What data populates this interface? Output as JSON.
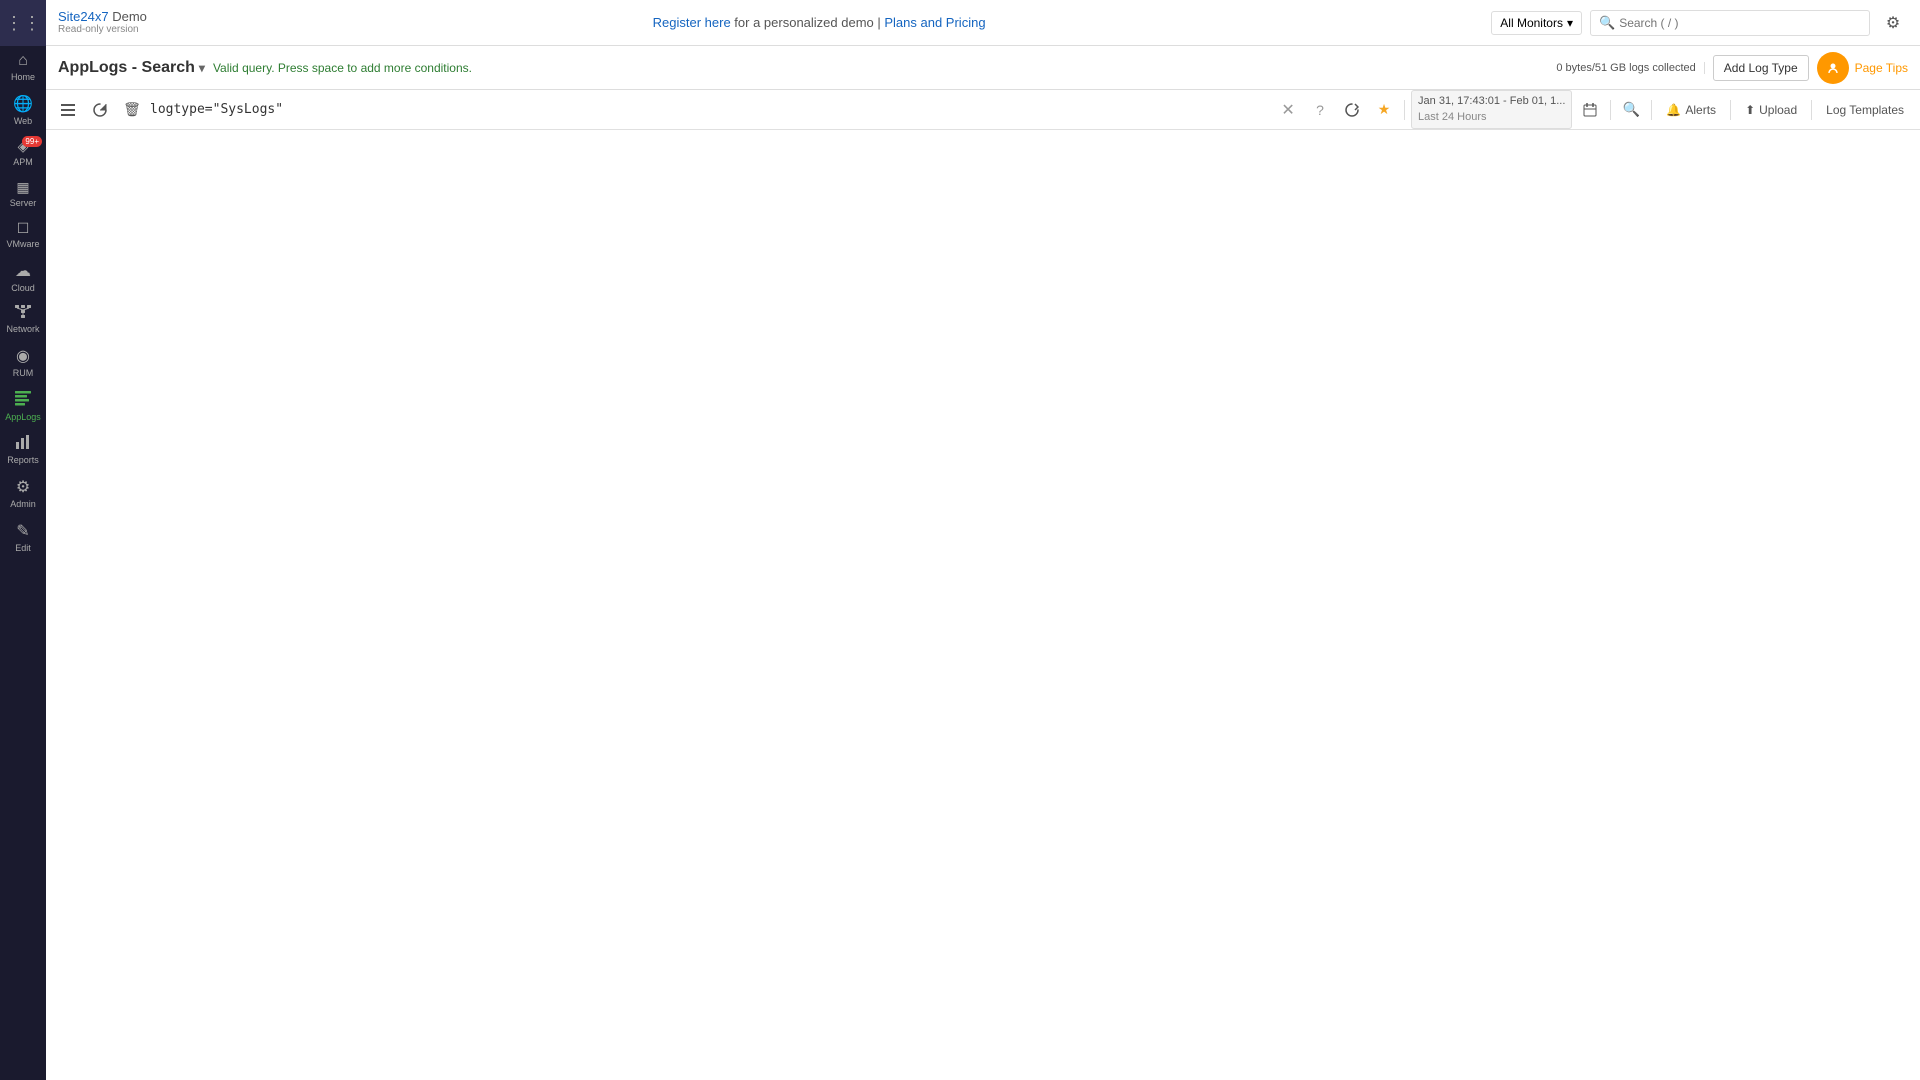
{
  "brand": {
    "site": "Site",
    "number": "24x7",
    "demo": "Demo",
    "readonly": "Read-only version"
  },
  "topbar": {
    "register_text": "Register here",
    "for_demo": " for a personalized demo | ",
    "plans": "Plans and Pricing",
    "monitor_dropdown": "All Monitors",
    "search_placeholder": "Search ( / )",
    "settings_icon": "⚙"
  },
  "subheader": {
    "title": "AppLogs - Search",
    "valid_query_msg": "Valid query. Press space to add more conditions.",
    "logs_collected": "0 bytes/51 GB logs collected",
    "add_log_type_label": "Add Log Type",
    "tips_label": "Page Tips"
  },
  "toolbar": {
    "query_value": "logtype=\"SysLogs\"",
    "datetime_range": "Jan 31, 17:43:01 - Feb 01, 1...",
    "datetime_period": "Last 24 Hours",
    "alerts_label": "Alerts",
    "upload_label": "Upload",
    "log_templates_label": "Log Templates"
  },
  "sidebar": {
    "grid_icon": "⊞",
    "items": [
      {
        "id": "home",
        "icon": "⌂",
        "label": "Home",
        "active": false,
        "badge": null
      },
      {
        "id": "web",
        "icon": "🌐",
        "label": "Web",
        "active": false,
        "badge": null
      },
      {
        "id": "apm",
        "icon": "◈",
        "label": "APM",
        "active": false,
        "badge": null
      },
      {
        "id": "server",
        "icon": "🖥",
        "label": "Server",
        "active": false,
        "badge": null
      },
      {
        "id": "vmware",
        "icon": "☐",
        "label": "VMware",
        "active": false,
        "badge": null
      },
      {
        "id": "cloud",
        "icon": "☁",
        "label": "Cloud",
        "active": false,
        "badge": null
      },
      {
        "id": "network",
        "icon": "⬡",
        "label": "Network",
        "active": false,
        "badge": null
      },
      {
        "id": "rum",
        "icon": "◉",
        "label": "RUM",
        "active": false,
        "badge": null
      },
      {
        "id": "applogs",
        "icon": "≋",
        "label": "AppLogs",
        "active": true,
        "badge": null
      },
      {
        "id": "reports",
        "icon": "📊",
        "label": "Reports",
        "active": false,
        "badge": null
      },
      {
        "id": "admin",
        "icon": "⚙",
        "label": "Admin",
        "active": false,
        "badge": null
      },
      {
        "id": "edit",
        "icon": "✎",
        "label": "Edit",
        "active": false,
        "badge": null
      }
    ],
    "alarms_badge": "99+"
  }
}
